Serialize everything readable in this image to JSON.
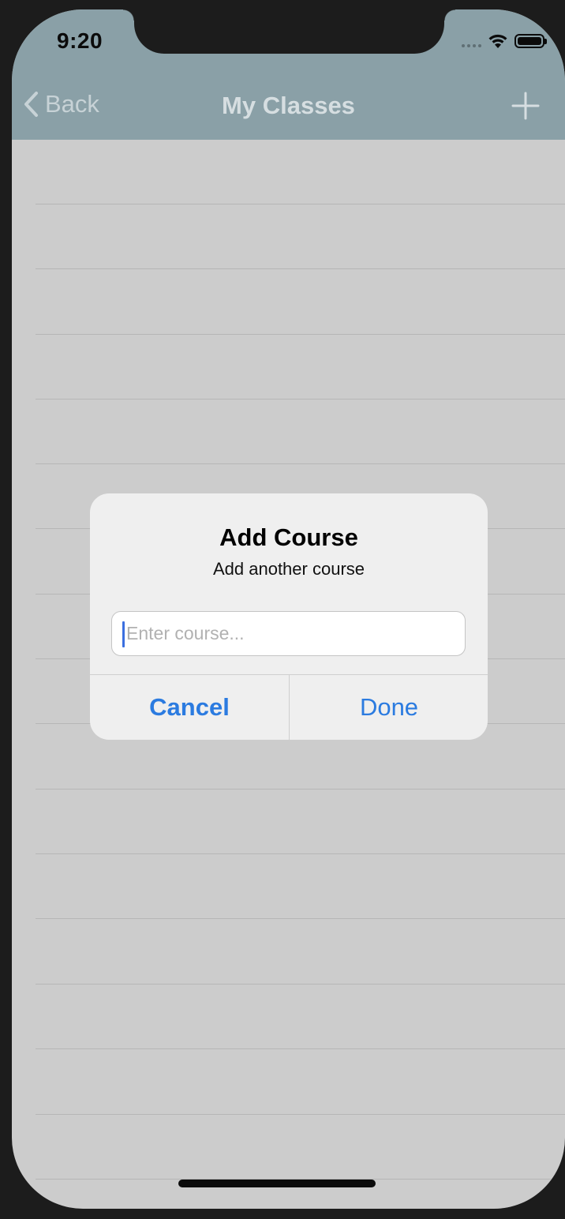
{
  "status_bar": {
    "time": "9:20"
  },
  "nav_bar": {
    "back_label": "Back",
    "title": "My Classes",
    "add_icon": "plus-icon"
  },
  "alert": {
    "title": "Add Course",
    "message": "Add another course",
    "input_value": "",
    "input_placeholder": "Enter course...",
    "cancel_label": "Cancel",
    "done_label": "Done"
  },
  "colors": {
    "nav_background": "#8aa0a7",
    "list_background": "#cccccc",
    "alert_button": "#2b7be0",
    "caret": "#3b6fe0"
  }
}
